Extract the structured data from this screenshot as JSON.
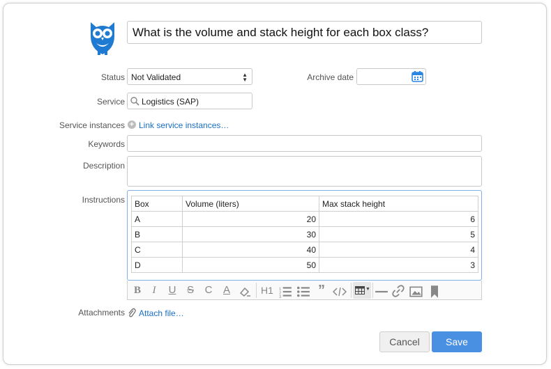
{
  "title": "What is the volume and stack height for each box class?",
  "status": {
    "label": "Status",
    "value": "Not Validated"
  },
  "archive_date": {
    "label": "Archive date",
    "value": ""
  },
  "service": {
    "label": "Service",
    "value": "Logistics (SAP)"
  },
  "service_instances": {
    "label": "Service instances",
    "link": "Link service instances…"
  },
  "keywords": {
    "label": "Keywords",
    "value": ""
  },
  "description": {
    "label": "Description",
    "value": ""
  },
  "instructions": {
    "label": "Instructions",
    "header": [
      "Box",
      "Volume (liters)",
      "Max stack height"
    ],
    "rows": [
      [
        "A",
        "20",
        "6"
      ],
      [
        "B",
        "30",
        "5"
      ],
      [
        "C",
        "40",
        "4"
      ],
      [
        "D",
        "50",
        "3"
      ]
    ]
  },
  "toolbar": {
    "bold": "B",
    "italic": "I",
    "underline": "U",
    "strike": "S",
    "clear": "C",
    "color": "A",
    "heading": "H1"
  },
  "attachments": {
    "label": "Attachments",
    "link": "Attach file…"
  },
  "buttons": {
    "cancel": "Cancel",
    "save": "Save"
  },
  "colors": {
    "accent": "#4a90e2",
    "link": "#1a6fc4",
    "owl": "#1f7ad1"
  }
}
